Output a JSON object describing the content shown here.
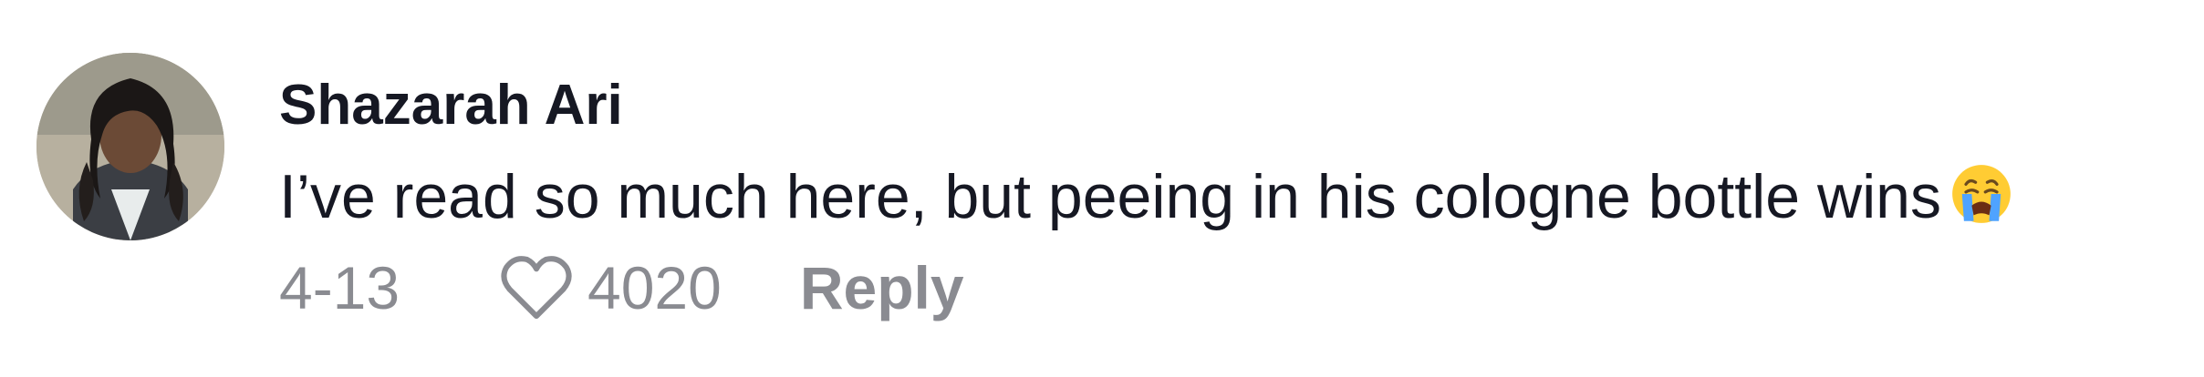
{
  "comment": {
    "username": "Shazarah Ari",
    "text": "I’ve read so much here, but peeing in his cologne bottle wins",
    "emoji": "loudly-crying-face",
    "date": "4-13",
    "like_count": "4020",
    "reply_label": "Reply"
  },
  "icons": {
    "like": "heart-outline-icon",
    "avatar": "user-avatar-photo"
  },
  "colors": {
    "primary_text": "#161823",
    "secondary_text": "#8a8b91",
    "background": "#ffffff"
  }
}
